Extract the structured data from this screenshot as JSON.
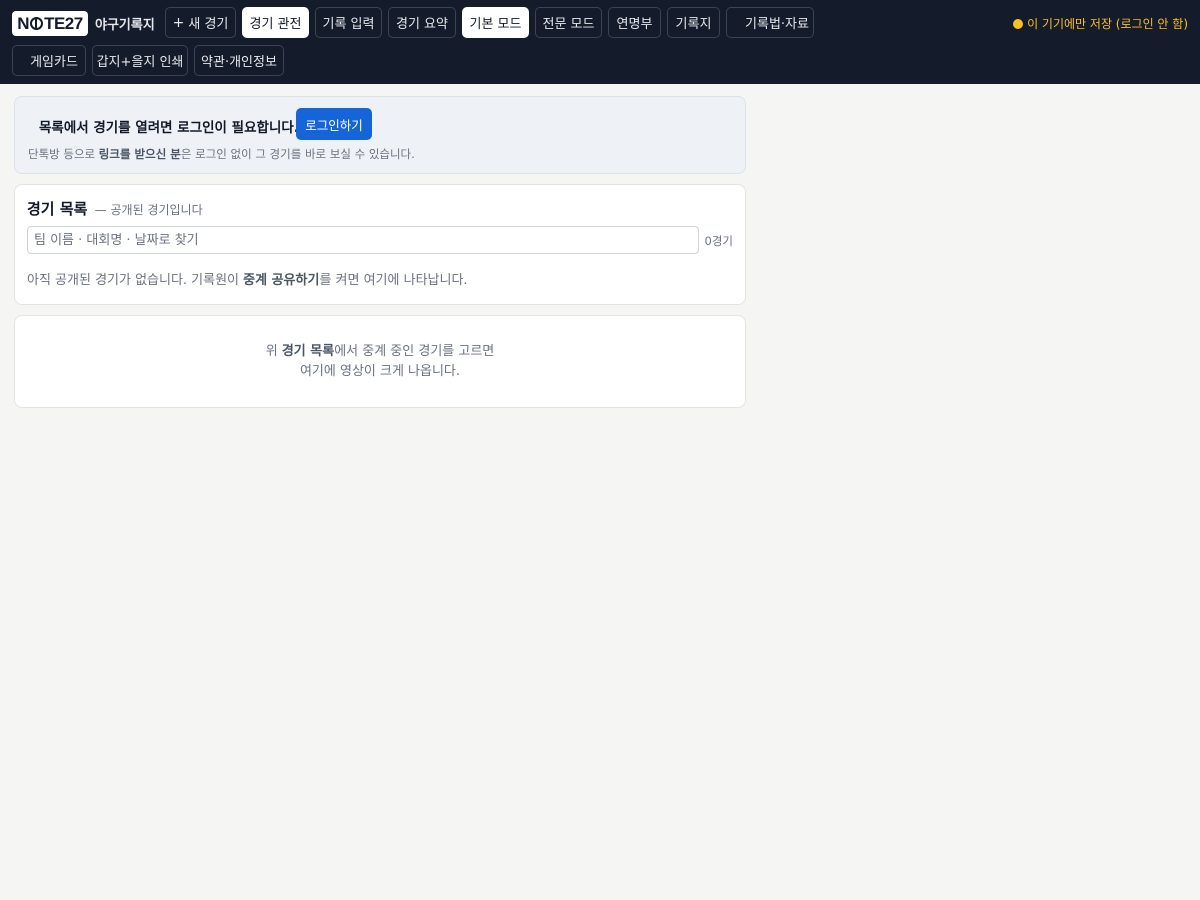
{
  "header": {
    "logo_text": "N  TE27",
    "app_name": "야구기록지",
    "storage_note": "이 기기에만 저장 (로그인 안 함)",
    "colors": {
      "bar": "#141b2b",
      "accent": "#fbbf24",
      "primary": "#1565d8"
    },
    "nav_row1": [
      {
        "label": "새 경기",
        "icon": "plus-icon"
      },
      {
        "label": "경기 관전",
        "active": true
      },
      {
        "label": "기록 입력"
      },
      {
        "label": "경기 요약"
      },
      {
        "label": "기본 모드",
        "active": true
      },
      {
        "label": "전문 모드"
      },
      {
        "label": "연명부"
      },
      {
        "label": "기록지"
      },
      {
        "label": "기록법·자료"
      }
    ],
    "nav_row2": [
      {
        "label": "게임카드"
      },
      {
        "label": "갑지+을지 인쇄"
      },
      {
        "label": "약관·개인정보"
      }
    ]
  },
  "login_banner": {
    "title": "목록에서 경기를 열려면 로그인이 필요합니다.",
    "button": "로그인하기",
    "sub_prefix": "단톡방 등으로 ",
    "sub_bold": "링크를 받으신 분",
    "sub_suffix": "은 로그인 없이 그 경기를 바로 보실 수 있습니다."
  },
  "game_list": {
    "title": "경기 목록",
    "desc": "— 공개된 경기입니다",
    "search_placeholder": "팀 이름 · 대회명 · 날짜로 찾기",
    "search_value": "",
    "count": "0경기",
    "empty_prefix": "아직 공개된 경기가 없습니다. 기록원이 ",
    "empty_bold": "중계 공유하기",
    "empty_suffix": "를 켜면 여기에 나타납니다."
  },
  "video_panel": {
    "line1_prefix": "위 ",
    "line1_bold": "경기 목록",
    "line1_suffix": "에서 중계 중인 경기를 고르면",
    "line2": "여기에 영상이 크게 나옵니다."
  }
}
